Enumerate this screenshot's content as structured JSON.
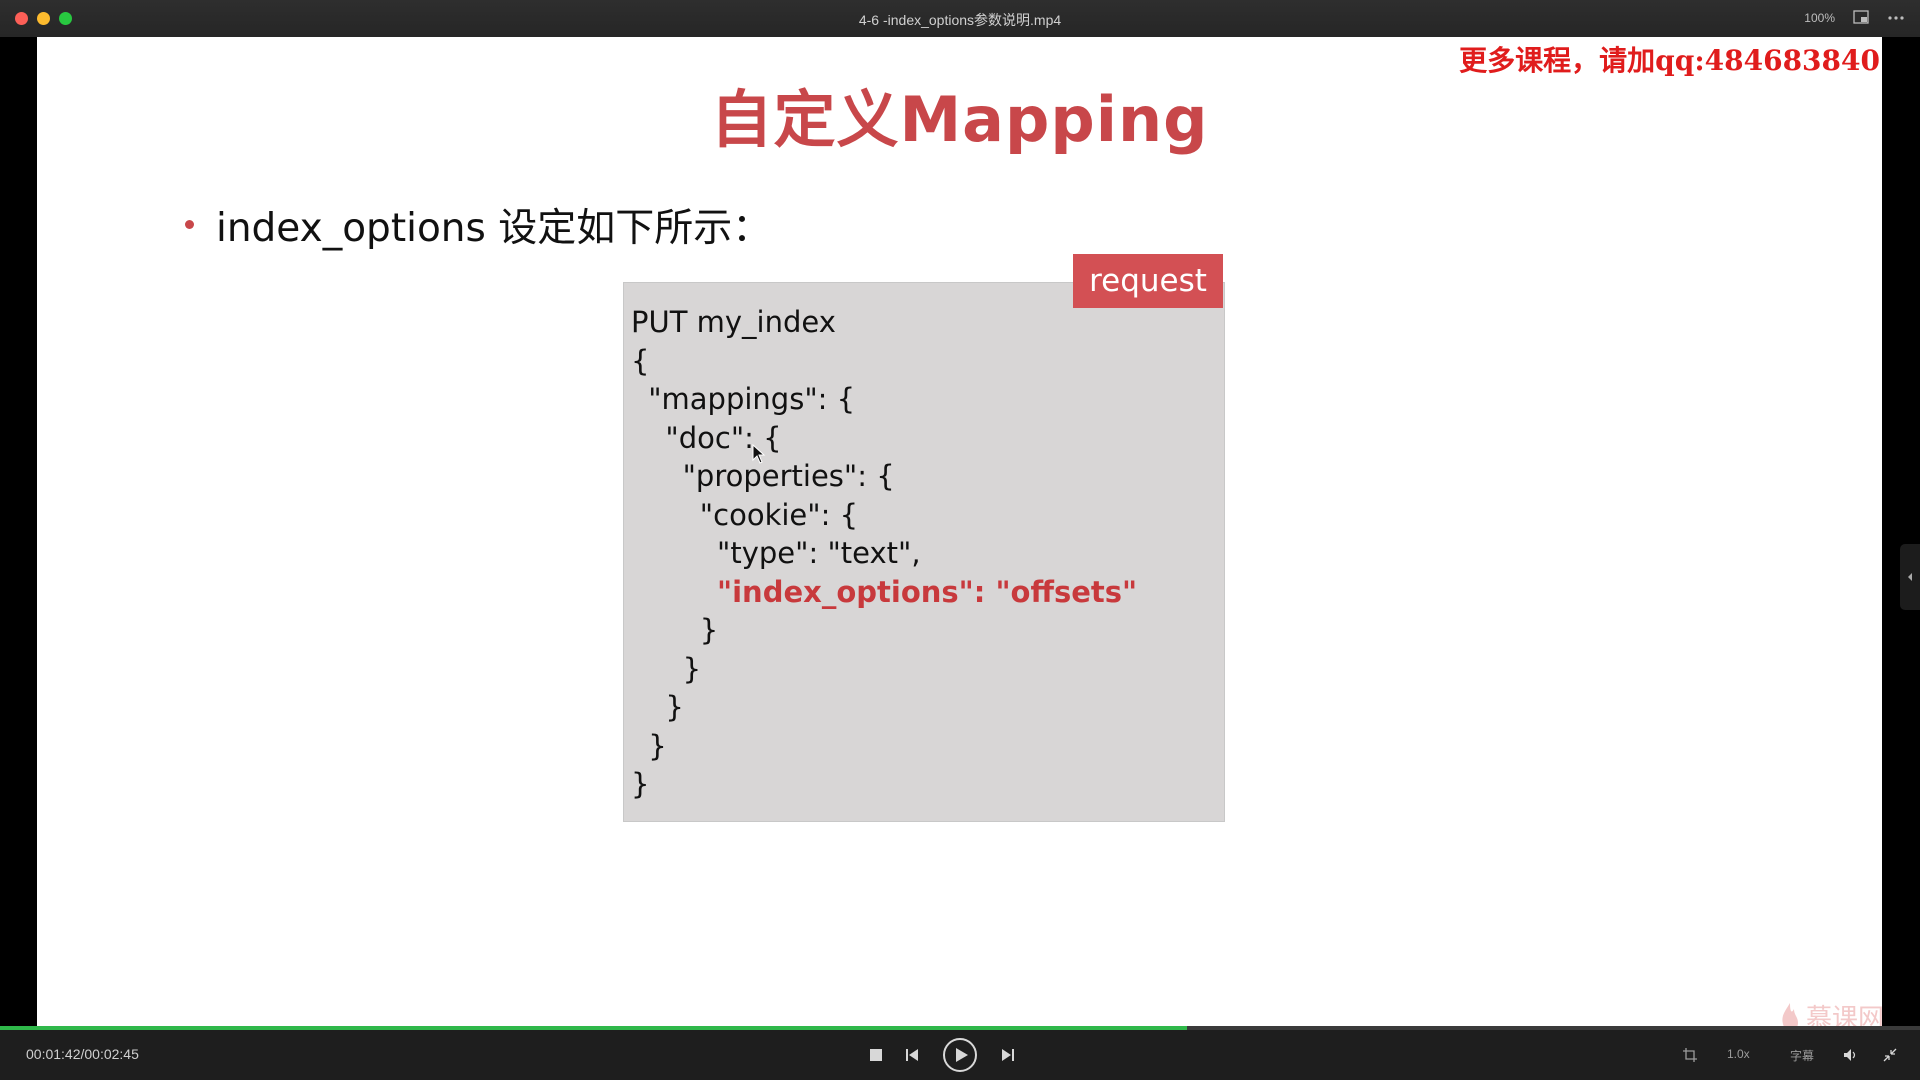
{
  "window": {
    "title": "4-6 -index_options参数说明.mp4",
    "zoom_level": "100%"
  },
  "icons": {
    "close": "close-icon",
    "minimize": "minimize-icon",
    "maximize": "maximize-icon",
    "pip": "picture-in-picture-icon",
    "more": "more-icon",
    "stop": "stop-icon",
    "previous": "skip-previous-icon",
    "play": "play-icon",
    "next": "skip-next-icon",
    "crop": "crop-icon",
    "volume": "volume-icon",
    "exit_fullscreen": "exit-fullscreen-icon",
    "side_panel": "chevron-left-icon"
  },
  "slide": {
    "watermark": "更多课程，请加qq:484683840",
    "title": "自定义Mapping",
    "bullet": "index_options 设定如下所示：",
    "badge": "request",
    "code": [
      "PUT my_index",
      "{",
      "  \"mappings\": {",
      "    \"doc\": {",
      "      \"properties\": {",
      "        \"cookie\": {",
      "          \"type\": \"text\",",
      "          \"index_options\": \"offsets\"",
      "        }",
      "      }",
      "    }",
      "  }",
      "}"
    ],
    "highlight_line": 7,
    "brand_logo": "慕课网"
  },
  "player": {
    "time": "00:01:42/00:02:45",
    "progress": 0.618,
    "speed_label": "1.0x",
    "subtitle_label": "字幕"
  },
  "colors": {
    "accent_red": "#c8474a",
    "watermark_red": "#e01c1c",
    "progress_green": "#2fb84a",
    "code_bg": "#d8d6d6"
  }
}
